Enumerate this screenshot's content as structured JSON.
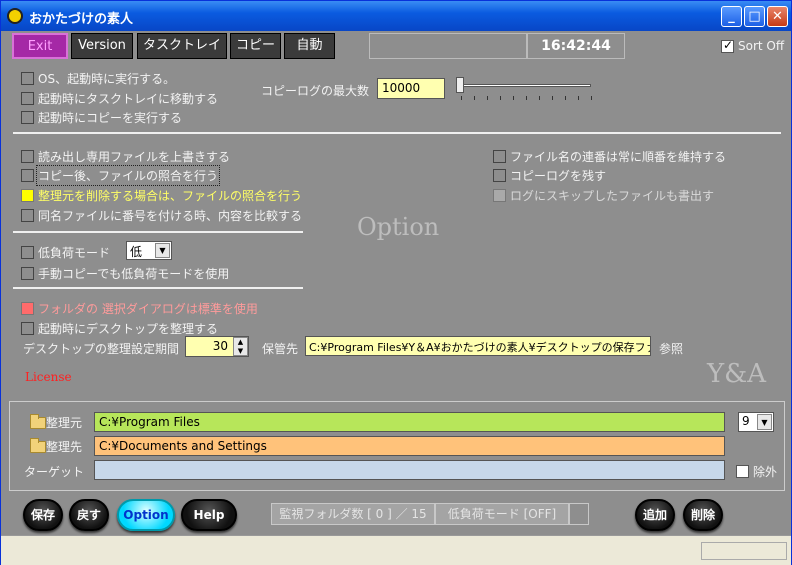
{
  "window": {
    "title": "おかたづけの素人"
  },
  "toolbar": {
    "exit": "Exit",
    "version": "Version",
    "tasktray": "タスクトレイ",
    "copy": "コピー",
    "auto": "自動",
    "clock": "16:42:44",
    "sort_off": "Sort Off"
  },
  "startup": {
    "run_on_os_start": "OS、起動時に実行する。",
    "move_to_tray": "起動時にタスクトレイに移動する",
    "copy_on_start": "起動時にコピーを実行する"
  },
  "copylog": {
    "label": "コピーログの最大数",
    "value": "10000"
  },
  "file_options": {
    "overwrite_readonly": "読み出し専用ファイルを上書きする",
    "verify_after_copy": "コピー後、ファイルの照合を行う",
    "verify_when_deleting": "整理元を削除する場合は、ファイルの照合を行う",
    "compare_when_numbering": "同名ファイルに番号を付ける時、内容を比較する",
    "keep_sequence": "ファイル名の連番は常に順番を維持する",
    "keep_copylog": "コピーログを残す",
    "log_skipped": "ログにスキップしたファイルも書出す"
  },
  "low_load": {
    "label": "低負荷モード",
    "level": "低",
    "manual_copy": "手動コピーでも低負荷モードを使用"
  },
  "folder_options": {
    "standard_dialog": "フォルダの 選択ダイアログは標準を使用",
    "organize_desktop": "起動時にデスクトップを整理する",
    "desktop_settings": "デスクトップの整理設定",
    "period_label": "期間",
    "period_value": "30",
    "storage_label": "保管先",
    "storage_value": "C:¥Program Files¥Y＆A¥おかたづけの素人¥デスクトップの保存ファ",
    "browse": "参照"
  },
  "watermarks": {
    "option": "Option",
    "brand": "Y&A"
  },
  "license": "License",
  "paths": {
    "source_label": "整理元",
    "source_value": "C:¥Program Files",
    "dest_label": "整理先",
    "dest_value": "C:¥Documents and Settings",
    "target_label": "ターゲット",
    "target_value": "",
    "index": "9",
    "exclude": "除外"
  },
  "buttons": {
    "save": "保存",
    "back": "戻す",
    "option": "Option",
    "help": "Help",
    "add": "追加",
    "delete": "削除"
  },
  "status": {
    "watched_folders": "監視フォルダ数 [ 0 ] ／ 15",
    "low_load_mode": "低負荷モード [OFF]"
  },
  "colors": {
    "titlebar": "#0a5be0",
    "panel": "#8e8e8e",
    "exit_button": "#a528a6",
    "source_field": "#b7e65a",
    "dest_field": "#ffc27a",
    "target_field": "#c7d8ea",
    "copylog_field": "#ffffb0",
    "license": "#ff2020"
  }
}
